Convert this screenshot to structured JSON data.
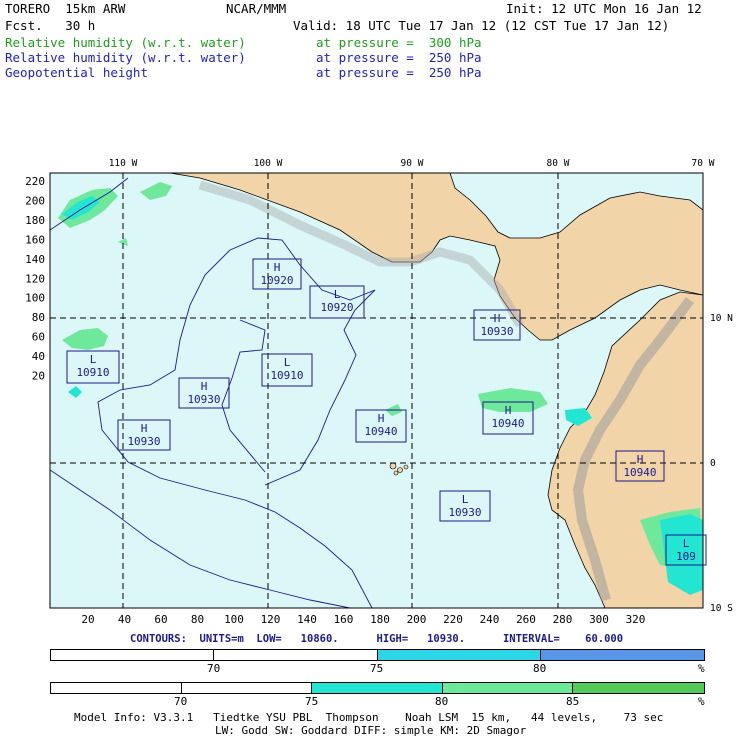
{
  "header": {
    "model": "TORERO  15km ARW",
    "org": "NCAR/MMM",
    "init": "Init: 12 UTC Mon 16 Jan 12",
    "fcst": "Fcst.   30 h",
    "valid": "Valid: 18 UTC Tue 17 Jan 12 (12 CST Tue 17 Jan 12)",
    "fields": [
      {
        "name": "Relative humidity (w.r.t. water)",
        "level": "at pressure =  300 hPa",
        "color": "#1f9d1f"
      },
      {
        "name": "Relative humidity (w.r.t. water)",
        "level": "at pressure =  250 hPa",
        "color": "#1f1fbf"
      },
      {
        "name": "Geopotential height",
        "level": "at pressure =  250 hPa",
        "color": "#1f1fbf"
      }
    ]
  },
  "map": {
    "top_lon_labels": [
      "110 W",
      "100 W",
      "90 W",
      "80 W",
      "70 W"
    ],
    "right_lat_labels": [
      "10 N",
      "0",
      "10 S"
    ],
    "y_ticks": [
      "220",
      "200",
      "180",
      "160",
      "140",
      "120",
      "100",
      "80",
      "60",
      "40",
      "20"
    ],
    "x_ticks": [
      "20",
      "40",
      "60",
      "80",
      "100",
      "120",
      "140",
      "160",
      "180",
      "200",
      "220",
      "240",
      "260",
      "280",
      "300",
      "320"
    ],
    "centers": [
      {
        "type": "H",
        "value": "10920"
      },
      {
        "type": "L",
        "value": "10920"
      },
      {
        "type": "H",
        "value": "10930"
      },
      {
        "type": "L",
        "value": "10910"
      },
      {
        "type": "L",
        "value": "10910"
      },
      {
        "type": "H",
        "value": "10930"
      },
      {
        "type": "H",
        "value": "10930"
      },
      {
        "type": "H",
        "value": "10940"
      },
      {
        "type": "H",
        "value": "10940"
      },
      {
        "type": "L",
        "value": "10930"
      },
      {
        "type": "H",
        "value": "10940"
      },
      {
        "type": "L",
        "value": "109"
      }
    ],
    "colors": {
      "ocean": "#dcf7f7",
      "land": "#f1d4a8",
      "contour": "#1a1a8c",
      "rh_cyan": "#1ae6d2",
      "rh_green": "#5ee68c"
    }
  },
  "contours_line": "CONTOURS:  UNITS=m  LOW=   10860.      HIGH=   10930.      INTERVAL=    60.000",
  "colorbar_250": {
    "labels": [
      "70",
      "75",
      "80",
      "%"
    ],
    "segments": [
      {
        "color": "#ffffff",
        "from": 0,
        "to": 0.25
      },
      {
        "color": "#ffffff",
        "from": 0.25,
        "to": 0.5
      },
      {
        "color": "#2cd6e6",
        "from": 0.5,
        "to": 0.75
      },
      {
        "color": "#5a96e8",
        "from": 0.75,
        "to": 1
      }
    ]
  },
  "colorbar_300": {
    "labels": [
      "70",
      "75",
      "80",
      "85",
      "%"
    ],
    "segments": [
      {
        "color": "#ffffff",
        "from": 0,
        "to": 0.2
      },
      {
        "color": "#ffffff",
        "from": 0.2,
        "to": 0.4
      },
      {
        "color": "#23e6d2",
        "from": 0.4,
        "to": 0.6
      },
      {
        "color": "#6ee89a",
        "from": 0.6,
        "to": 0.8
      },
      {
        "color": "#55cc55",
        "from": 0.8,
        "to": 1
      }
    ]
  },
  "footer": {
    "line1": "Model Info: V3.3.1   Tiedtke YSU PBL  Thompson    Noah LSM  15 km,   44 levels,    73 sec",
    "line2": "LW: Godd SW: Goddard DIFF: simple KM: 2D Smagor"
  }
}
